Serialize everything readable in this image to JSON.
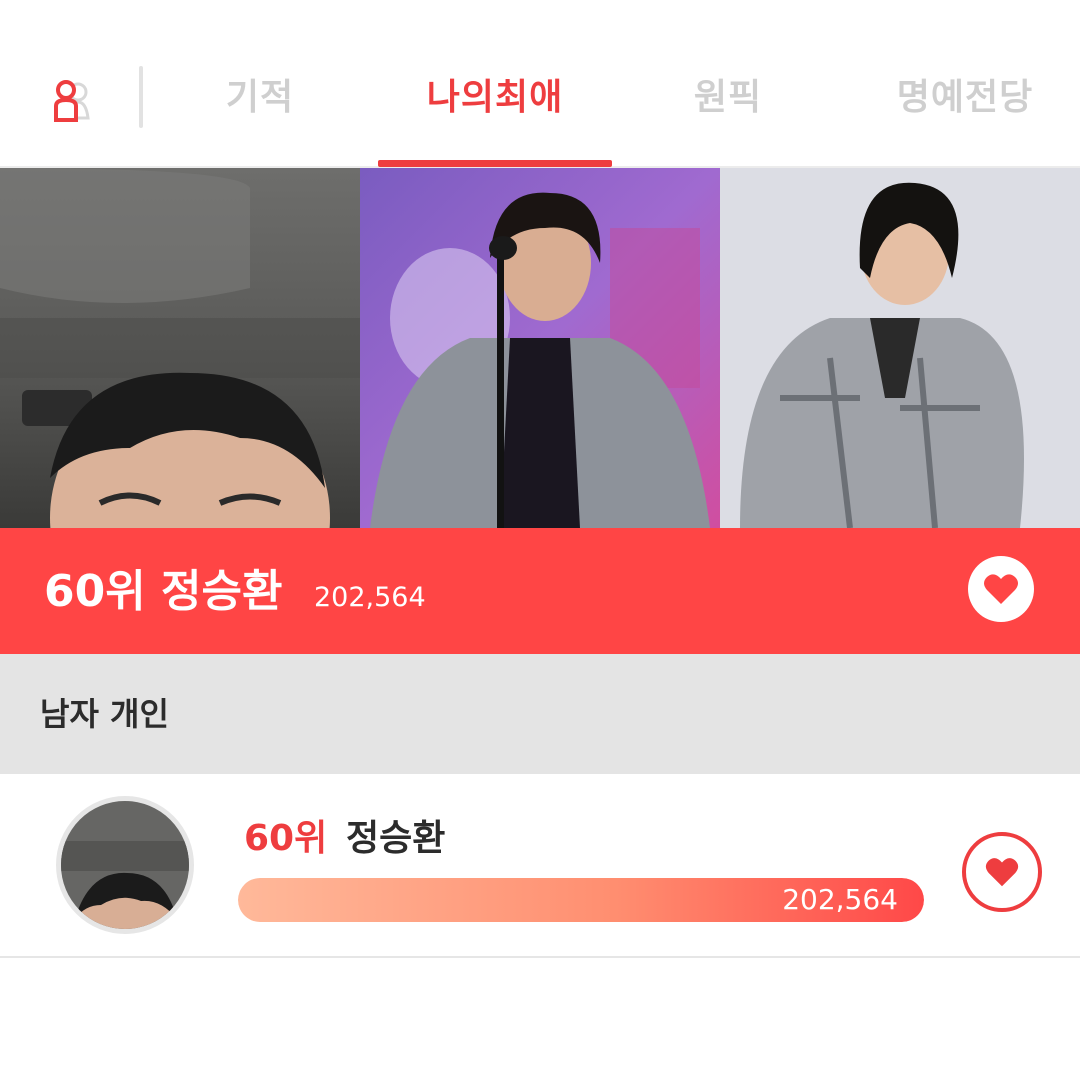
{
  "tabs": [
    {
      "label": "기적",
      "active": false
    },
    {
      "label": "나의최애",
      "active": true
    },
    {
      "label": "원픽",
      "active": false
    },
    {
      "label": "명예전당",
      "active": false
    }
  ],
  "banner": {
    "rank_name": "60위 정승환",
    "count": "202,564"
  },
  "section": {
    "title": "남자 개인"
  },
  "row": {
    "rank": "60위",
    "name": "정승환",
    "count": "202,564",
    "progress_fraction": 1.0
  },
  "colors": {
    "accent": "#ee3d3f",
    "banner": "#ff4545",
    "section_bg": "#e4e4e4",
    "inactive_tab": "#cfcfcf"
  },
  "icons": [
    "profile-icon",
    "heart-icon"
  ]
}
